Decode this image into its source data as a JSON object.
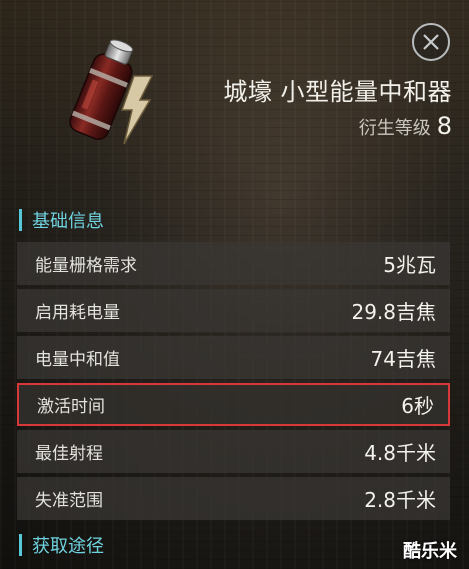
{
  "item": {
    "name": "城壕 小型能量中和器",
    "level_label": "衍生等级",
    "level_value": "8"
  },
  "sections": {
    "basic_info_title": "基础信息",
    "acquire_title": "获取途径"
  },
  "attributes": [
    {
      "label": "能量栅格需求",
      "value": "5兆瓦"
    },
    {
      "label": "启用耗电量",
      "value": "29.8吉焦"
    },
    {
      "label": "电量中和值",
      "value": "74吉焦"
    },
    {
      "label": "激活时间",
      "value": "6秒"
    },
    {
      "label": "最佳射程",
      "value": "4.8千米"
    },
    {
      "label": "失准范围",
      "value": "2.8千米"
    }
  ],
  "highlighted_row": "激活时间",
  "watermark": "酷乐米",
  "icons": {
    "close": "close-icon",
    "item": "energy-neutralizer-icon"
  },
  "colors": {
    "accent": "#56c8d8",
    "highlight_border": "#d9383a"
  }
}
